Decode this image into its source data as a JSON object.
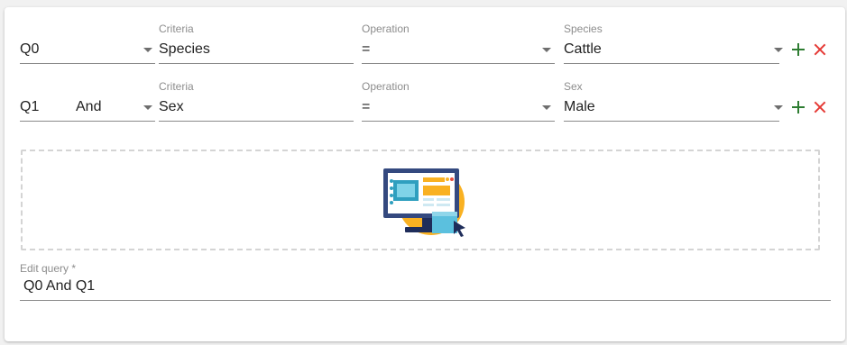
{
  "rows": [
    {
      "query_id": "Q0",
      "conjunction": "",
      "criteria_label": "Criteria",
      "criteria_value": "Species",
      "operation_label": "Operation",
      "operation_value": "=",
      "value_label": "Species",
      "value_value": "Cattle"
    },
    {
      "query_id": "Q1",
      "conjunction": "And",
      "criteria_label": "Criteria",
      "criteria_value": "Sex",
      "operation_label": "Operation",
      "operation_value": "=",
      "value_label": "Sex",
      "value_value": "Male"
    }
  ],
  "edit_query": {
    "label": "Edit query *",
    "value": "Q0 And Q1"
  },
  "icons": {
    "add": "plus-icon",
    "remove": "close-icon",
    "dropdown": "caret-down-icon",
    "illustration": "computer-monitor-cursor-illustration"
  },
  "colors": {
    "add": "#2e7d32",
    "remove": "#e53935",
    "accent_orange": "#f9b122",
    "screen_blue": "#34497f",
    "panel_teal": "#5bc0de"
  }
}
